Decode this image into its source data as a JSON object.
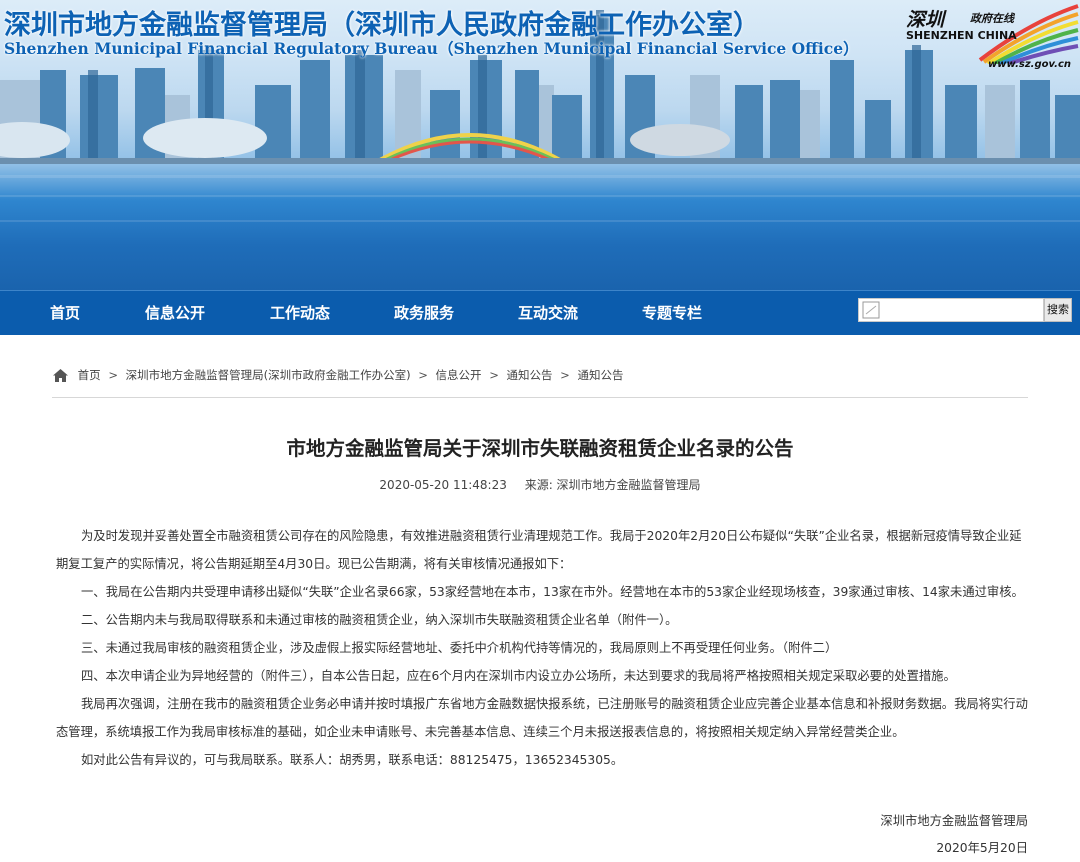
{
  "header": {
    "title": "深圳市地方金融监督管理局（深圳市人民政府金融工作办公室）",
    "subtitle": "Shenzhen Municipal Financial Regulatory Bureau（Shenzhen Municipal Financial Service Office）",
    "logo": {
      "cn": "深圳",
      "gov": "政府在线",
      "en": "SHENZHEN CHINA",
      "url": "www.sz.gov.cn"
    }
  },
  "nav": {
    "items": [
      "首页",
      "信息公开",
      "工作动态",
      "政务服务",
      "互动交流",
      "专题专栏"
    ],
    "search_button": "搜索",
    "search_placeholder": ""
  },
  "breadcrumb": [
    "首页",
    "深圳市地方金融监督管理局(深圳市政府金融工作办公室)",
    "信息公开",
    "通知公告",
    "通知公告"
  ],
  "article": {
    "title": "市地方金融监管局关于深圳市失联融资租赁企业名录的公告",
    "datetime": "2020-05-20 11:48:23",
    "source": "来源: 深圳市地方金融监督管理局",
    "paragraphs": [
      "为及时发现并妥善处置全市融资租赁公司存在的风险隐患，有效推进融资租赁行业清理规范工作。我局于2020年2月20日公布疑似“失联”企业名录，根据新冠疫情导致企业延期复工复产的实际情况，将公告期延期至4月30日。现已公告期满，将有关审核情况通报如下：",
      "一、我局在公告期内共受理申请移出疑似“失联”企业名录66家，53家经营地在本市，13家在市外。经营地在本市的53家企业经现场核查，39家通过审核、14家未通过审核。",
      "二、公告期内未与我局取得联系和未通过审核的融资租赁企业，纳入深圳市失联融资租赁企业名单（附件一）。",
      "三、未通过我局审核的融资租赁企业，涉及虚假上报实际经营地址、委托中介机构代持等情况的，我局原则上不再受理任何业务。（附件二）",
      "四、本次申请企业为异地经营的（附件三），自本公告日起，应在6个月内在深圳市内设立办公场所，未达到要求的我局将严格按照相关规定采取必要的处置措施。",
      "我局再次强调，注册在我市的融资租赁企业务必申请并按时填报广东省地方金融数据快报系统，已注册账号的融资租赁企业应完善企业基本信息和补报财务数据。我局将实行动态管理，系统填报工作为我局审核标准的基础，如企业未申请账号、未完善基本信息、连续三个月未报送报表信息的，将按照相关规定纳入异常经营类企业。",
      "如对此公告有异议的，可与我局联系。联系人：胡秀男，联系电话：88125475，13652345305。"
    ],
    "signature": "深圳市地方金融监督管理局",
    "date": "2020年5月20日"
  }
}
